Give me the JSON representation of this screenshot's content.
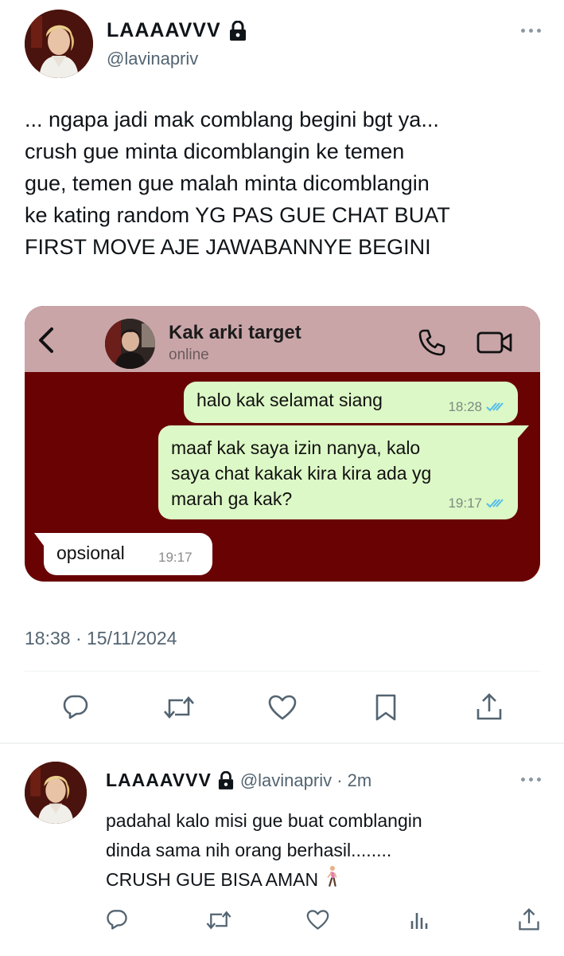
{
  "post": {
    "display_name": "LAAAAVVV",
    "handle": "@lavinapriv",
    "text_lines": [
      "... ngapa jadi mak comblang begini bgt ya...",
      "crush gue minta dicomblangin ke temen",
      "gue, temen gue malah minta dicomblangin",
      "ke kating random YG PAS GUE CHAT BUAT",
      "FIRST MOVE AJE JAWABANNYE BEGINI"
    ],
    "timestamp": "18:38 · 15/11/2024"
  },
  "chat_screenshot": {
    "contact_name": "Kak arki target",
    "contact_status": "online",
    "background_color": "#690303",
    "header_color": "#c9a5a8",
    "messages": [
      {
        "direction": "outgoing",
        "lines": [
          "halo kak selamat siang"
        ],
        "time": "18:28",
        "read": true
      },
      {
        "direction": "outgoing",
        "lines": [
          "maaf kak saya izin nanya, kalo",
          "saya chat kakak kira kira ada yg",
          "marah ga kak?"
        ],
        "time": "19:17",
        "read": true
      },
      {
        "direction": "incoming",
        "lines": [
          "opsional"
        ],
        "time": "19:17"
      }
    ]
  },
  "reply": {
    "display_name": "LAAAAVVV",
    "handle_time": "@lavinapriv · 2m",
    "text_lines": [
      "padahal kalo misi gue buat comblangin",
      "dinda sama nih orang berhasil........",
      "CRUSH GUE BISA AMAN"
    ],
    "emoji": "person-walking-emoji"
  },
  "icons": {
    "lock": "lock-icon",
    "more": "more-icon",
    "reply": "reply-icon",
    "retweet": "retweet-icon",
    "like": "like-icon",
    "bookmark": "bookmark-icon",
    "share": "share-icon",
    "views": "views-icon"
  },
  "colors": {
    "text": "#0f1419",
    "secondary": "#536471",
    "read_ticks": "#53bdeb",
    "bubble_out": "#dcf8c6"
  }
}
